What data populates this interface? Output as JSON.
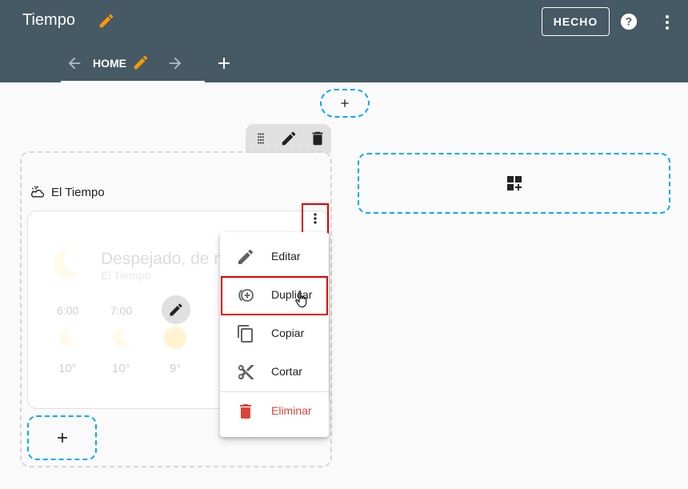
{
  "header": {
    "title": "Tiempo",
    "done_label": "HECHO",
    "background": "#455a64",
    "edit_color": "#ff9800"
  },
  "tabs": [
    {
      "label": "HOME",
      "selected": true
    }
  ],
  "section": {
    "heading": "El Tiempo"
  },
  "weather_card": {
    "state": "Despejado, de noche",
    "entity_name": "El Tiempo",
    "forecast": [
      {
        "time": "6:00",
        "temp": "10°",
        "icon": "moon-icon"
      },
      {
        "time": "7:00",
        "temp": "10°",
        "icon": "moon-icon"
      },
      {
        "time": "",
        "temp": "9°",
        "icon": "sun-icon"
      }
    ]
  },
  "menu": {
    "items": [
      {
        "label": "Editar",
        "icon": "pencil-icon"
      },
      {
        "label": "Duplicar",
        "icon": "duplicate-icon"
      },
      {
        "label": "Copiar",
        "icon": "copy-icon"
      },
      {
        "label": "Cortar",
        "icon": "scissors-icon"
      },
      {
        "label": "Eliminar",
        "icon": "trash-icon",
        "color": "#db4437"
      }
    ]
  },
  "accent": {
    "dashed_border": "#03a9f4",
    "highlight_border": "#e00000"
  }
}
